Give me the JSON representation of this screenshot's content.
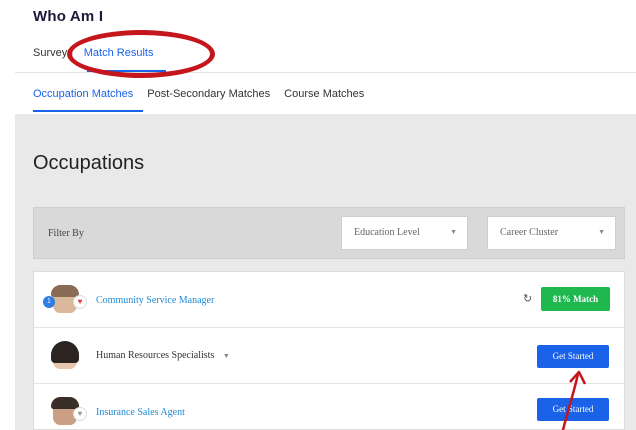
{
  "app": {
    "title": "Who Am I"
  },
  "top_tabs": [
    {
      "label": "Surveys",
      "active": false
    },
    {
      "label": "Match Results",
      "active": true
    }
  ],
  "sub_tabs": [
    {
      "label": "Occupation Matches",
      "active": true
    },
    {
      "label": "Post-Secondary Matches",
      "active": false
    },
    {
      "label": "Course Matches",
      "active": false
    }
  ],
  "section": {
    "heading": "Occupations"
  },
  "filter": {
    "label": "Filter By",
    "selects": [
      {
        "value": "Education Level",
        "caret_icon": "chevron-down-icon"
      },
      {
        "value": "Career Cluster",
        "caret_icon": "chevron-down-icon"
      }
    ]
  },
  "results": [
    {
      "name": "Community Service Manager",
      "match_label": "81% Match",
      "badge_number": "1"
    },
    {
      "name": "Human Resources Specialists",
      "button_label": "Get Started"
    },
    {
      "name": "Insurance Sales Agent",
      "button_label": "Get Started"
    }
  ],
  "icons": {
    "refresh": "↻",
    "heart": "♥",
    "caret": "▼"
  },
  "colors": {
    "accent": "#1a62e8",
    "match_green": "#1fb84f",
    "link_blue": "#1f8ad6",
    "annotation_red": "#c4161c"
  }
}
